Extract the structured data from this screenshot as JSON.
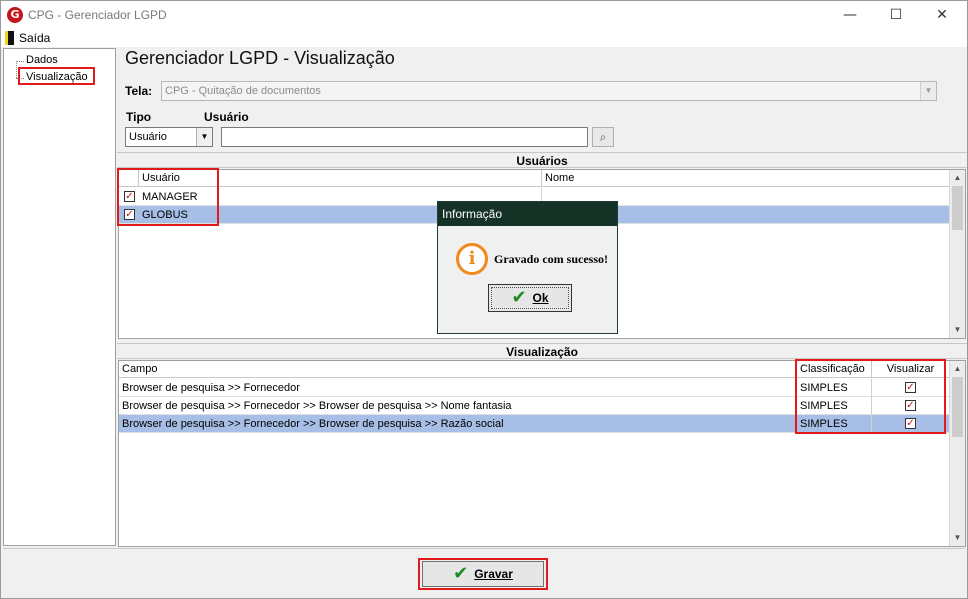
{
  "window": {
    "title": "CPG - Gerenciador LGPD",
    "app_icon_letter": "G",
    "minimize": "—",
    "maximize": "☐",
    "close": "✕"
  },
  "menu": {
    "items": [
      {
        "label": "Saída"
      }
    ]
  },
  "tree": {
    "items": [
      {
        "label": "Dados"
      },
      {
        "label": "Visualização",
        "selected": true
      }
    ]
  },
  "header": {
    "title": "Gerenciador LGPD - Visualização"
  },
  "tela": {
    "label": "Tela:",
    "value": "CPG - Quitação de documentos"
  },
  "filters": {
    "tipo_label": "Tipo",
    "usuario_label": "Usuário",
    "tipo_value": "Usuário",
    "usuario_value": ""
  },
  "usuarios": {
    "title": "Usuários",
    "columns": [
      "Usuário",
      "Nome"
    ],
    "rows": [
      {
        "usuario": "MANAGER",
        "nome": "",
        "checked": true,
        "selected": false
      },
      {
        "usuario": "GLOBUS",
        "nome": "",
        "checked": true,
        "selected": true
      }
    ]
  },
  "visualizacao": {
    "title": "Visualização",
    "columns": [
      "Campo",
      "Classificação",
      "Visualizar"
    ],
    "rows": [
      {
        "campo": "Browser de pesquisa >> Fornecedor",
        "classificacao": "SIMPLES",
        "visualizar": true,
        "selected": false
      },
      {
        "campo": "Browser de pesquisa >> Fornecedor >> Browser de pesquisa >>  Nome fantasia",
        "classificacao": "SIMPLES",
        "visualizar": true,
        "selected": false
      },
      {
        "campo": "Browser de pesquisa >> Fornecedor >> Browser de pesquisa >>  Razão social",
        "classificacao": "SIMPLES",
        "visualizar": true,
        "selected": true
      }
    ]
  },
  "dialog": {
    "title": "Informação",
    "message": "Gravado com sucesso!",
    "ok_label": "Ok",
    "icon": "info-icon"
  },
  "footer": {
    "gravar_label": "Gravar"
  },
  "colors": {
    "highlight_box": "#e01b1b",
    "selected_row": "#a7bfe6",
    "dialog_title_bg": "#143226",
    "info_icon": "#f08a1e",
    "check_icon": "#1f8a1f"
  }
}
